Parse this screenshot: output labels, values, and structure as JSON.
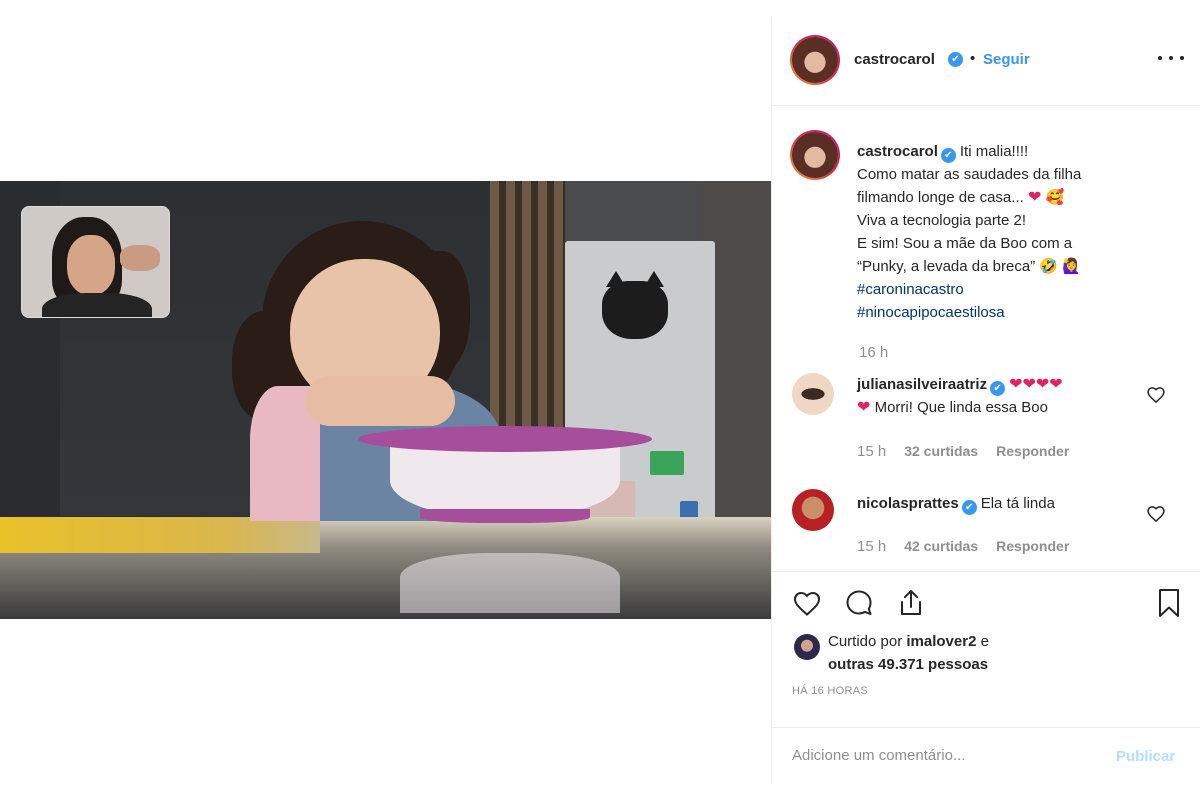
{
  "post": {
    "username": "castrocarol",
    "verified_mark": "✔",
    "separator": "•",
    "follow_label": "Seguir",
    "more_icon": "ellipsis-icon"
  },
  "caption": {
    "username": "castrocarol",
    "first_line": "Iti malia!!!!",
    "line2": "Como matar as saudades da filha",
    "line3": "filmando longe de casa...",
    "line3_emojis": [
      "❤",
      "🥰"
    ],
    "line4": "Viva a tecnologia parte 2!",
    "line5": "E sim! Sou a mãe da Boo com a",
    "line6": "“Punky, a levada da breca”",
    "line6_emojis": [
      "🤣",
      "🙋‍♀️"
    ],
    "hashtags": [
      "#caroninacastro",
      "#ninocapipocaestilosa"
    ],
    "time": "16 h"
  },
  "comments": [
    {
      "username": "julianasilveiraatriz",
      "hearts": "❤❤❤❤",
      "text": "Morri! Que linda essa Boo",
      "text_prefix": "❤",
      "time": "15 h",
      "likes": "32 curtidas",
      "reply": "Responder"
    },
    {
      "username": "nicolasprattes",
      "text": "Ela tá linda",
      "time": "15 h",
      "likes": "42 curtidas",
      "reply": "Responder"
    }
  ],
  "actions": {
    "icons": [
      "heart-icon",
      "comment-icon",
      "share-icon",
      "bookmark-icon"
    ],
    "liked_prefix": "Curtido por",
    "liked_user": "imalover2",
    "liked_conj": "e",
    "liked_others": "outras 49.371 pessoas",
    "time_ago": "HÁ 16 HORAS"
  },
  "comment_box": {
    "placeholder": "Adicione um comentário...",
    "publish_label": "Publicar"
  },
  "colors": {
    "accent": "#3897f0",
    "hashtag": "#003569",
    "muted": "#8e8e8e",
    "heart": "#e0245e",
    "publish_disabled": "#b2dffc"
  }
}
